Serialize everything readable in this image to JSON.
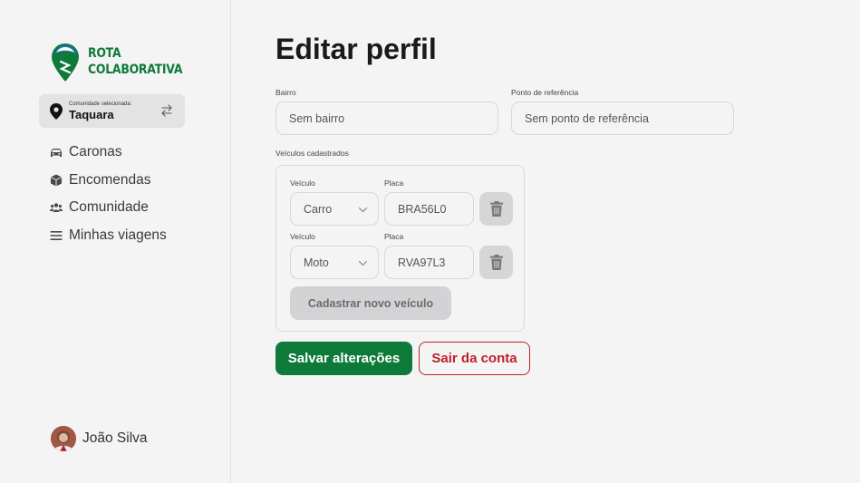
{
  "brand": {
    "line1": "ROTA",
    "line2": "COLABORATIVA",
    "color": "#0f7a3a",
    "logo_icon": "map-pin-mountain-icon"
  },
  "community": {
    "caption": "Comunidade selecionada:",
    "name": "Taquara",
    "icon": "location-pin-icon",
    "swap_icon": "swap-arrows-icon"
  },
  "nav": {
    "items": [
      {
        "label": "Caronas",
        "icon": "car-icon"
      },
      {
        "label": "Encomendas",
        "icon": "package-icon"
      },
      {
        "label": "Comunidade",
        "icon": "users-icon"
      },
      {
        "label": "Minhas viagens",
        "icon": "list-icon"
      }
    ]
  },
  "user": {
    "name": "João Silva"
  },
  "page": {
    "title": "Editar perfil",
    "bairro": {
      "label": "Bairro",
      "placeholder": "Sem bairro"
    },
    "referencia": {
      "label": "Ponto de referência",
      "placeholder": "Sem ponto de referência"
    },
    "vehicles_label": "Veículos cadastrados",
    "vehicles": [
      {
        "type_label": "Veículo",
        "type": "Carro",
        "plate_label": "Placa",
        "plate": "BRA56L0"
      },
      {
        "type_label": "Veículo",
        "type": "Moto",
        "plate_label": "Placa",
        "plate": "RVA97L3"
      }
    ],
    "add_vehicle": "Cadastrar novo veículo",
    "save": "Salvar alterações",
    "logout": "Sair da conta"
  },
  "colors": {
    "primary": "#0e7a3a",
    "danger": "#c0202a",
    "background": "#f4f4f4"
  }
}
